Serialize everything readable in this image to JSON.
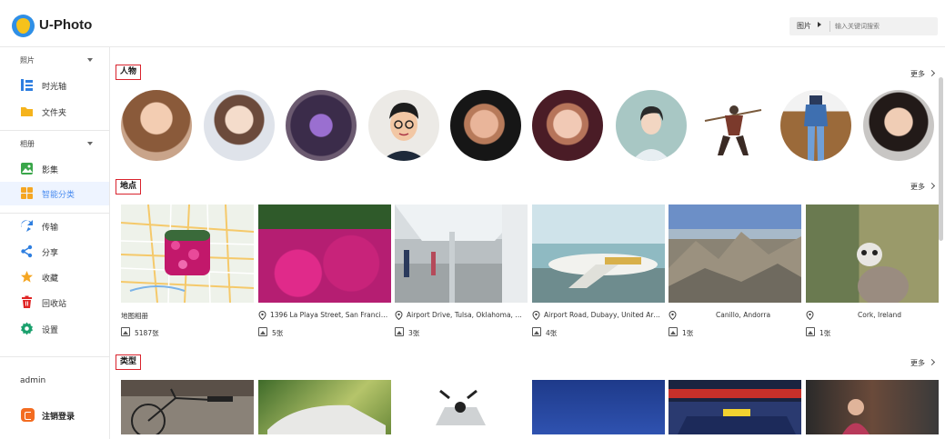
{
  "app": {
    "title": "U-Photo"
  },
  "search": {
    "type_label": "图片",
    "placeholder": "输入关键词搜索"
  },
  "sidebar": {
    "photos_group": "照片",
    "albums_group": "相册",
    "items": [
      {
        "label": "时光轴",
        "icon": "timeline-icon"
      },
      {
        "label": "文件夹",
        "icon": "folder-icon"
      },
      {
        "label": "影集",
        "icon": "album-icon"
      },
      {
        "label": "智能分类",
        "icon": "smart-category-icon"
      },
      {
        "label": "传输",
        "icon": "transfer-icon"
      },
      {
        "label": "分享",
        "icon": "share-icon"
      },
      {
        "label": "收藏",
        "icon": "star-icon"
      },
      {
        "label": "回收站",
        "icon": "trash-icon"
      },
      {
        "label": "设置",
        "icon": "gear-icon"
      }
    ],
    "user": "admin",
    "logout": "注销登录"
  },
  "sections": {
    "people": {
      "title": "人物",
      "more": "更多"
    },
    "places": {
      "title": "地点",
      "more": "更多",
      "items": [
        {
          "caption": "地图相册",
          "count": "5187张"
        },
        {
          "caption": "1396 La Playa Street, San Francis...",
          "count": "5张"
        },
        {
          "caption": "Airport Drive, Tulsa, Oklahoma, Un...",
          "count": "3张"
        },
        {
          "caption": "Airport Road, Dubayy, United Arab...",
          "count": "4张"
        },
        {
          "caption": "Canillo, Andorra",
          "count": "1张"
        },
        {
          "caption": "Cork, Ireland",
          "count": "1张"
        }
      ]
    },
    "types": {
      "title": "类型",
      "more": "更多"
    }
  },
  "colors": {
    "accent": "#4a8cf0",
    "section_border": "#d9232d",
    "logout": "#f36c21"
  }
}
